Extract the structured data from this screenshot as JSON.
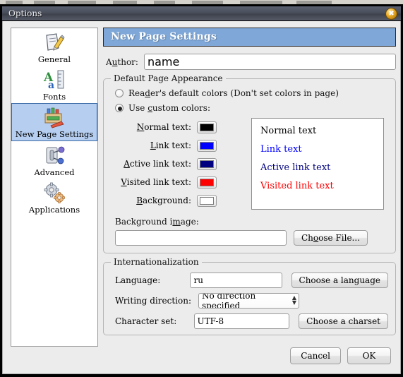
{
  "window": {
    "title": "Options",
    "close_icon": "close-icon"
  },
  "sidebar": {
    "items": [
      {
        "label": "General",
        "icon": "pencil-document-icon",
        "selected": false
      },
      {
        "label": "Fonts",
        "icon": "font-ruler-icon",
        "selected": false
      },
      {
        "label": "New Page Settings",
        "icon": "crayon-box-icon",
        "selected": true
      },
      {
        "label": "Advanced",
        "icon": "toggle-switch-icon",
        "selected": false
      },
      {
        "label": "Applications",
        "icon": "gears-icon",
        "selected": false
      }
    ]
  },
  "page": {
    "header": "New Page Settings",
    "author": {
      "label_pre": "A",
      "label_mnemonic": "u",
      "label_post": "thor:",
      "value": "name",
      "placeholder": ""
    },
    "appearance": {
      "title": "Default Page Appearance",
      "radio_default": {
        "pre": "Rea",
        "mnemonic": "d",
        "post": "er's default colors (Don't set colors in page)",
        "selected": false
      },
      "radio_custom": {
        "pre": "Use ",
        "mnemonic": "c",
        "post": "ustom colors:",
        "selected": true
      },
      "colors": [
        {
          "pre": "",
          "mnemonic": "N",
          "post": "ormal text:",
          "value": "#000000"
        },
        {
          "pre": "",
          "mnemonic": "L",
          "post": "ink text:",
          "value": "#0000ff"
        },
        {
          "pre": "",
          "mnemonic": "A",
          "post": "ctive link text:",
          "value": "#000080"
        },
        {
          "pre": "",
          "mnemonic": "V",
          "post": "isited link text:",
          "value": "#ff0000"
        },
        {
          "pre": "",
          "mnemonic": "B",
          "post": "ackground:",
          "value": "#ffffff"
        }
      ],
      "preview": [
        {
          "text": "Normal text",
          "color": "#000000"
        },
        {
          "text": "Link text",
          "color": "#0000ff"
        },
        {
          "text": "Active link text",
          "color": "#000080"
        },
        {
          "text": "Visited link text",
          "color": "#ff0000"
        }
      ],
      "preview_bg": "#ffffff",
      "bg_image": {
        "pre": "Background i",
        "mnemonic": "m",
        "post": "age:",
        "value": "",
        "placeholder": "",
        "button_pre": "Ch",
        "button_mnemonic": "o",
        "button_post": "ose File..."
      }
    },
    "internationalization": {
      "title": "Internationalization",
      "language": {
        "label": "Language:",
        "value": "ru",
        "button": "Choose a language"
      },
      "writing_direction": {
        "label": "Writing direction:",
        "value": "No direction specified",
        "arrows_icon": "chevron-updown-icon"
      },
      "charset": {
        "label": "Character set:",
        "value": "UTF-8",
        "button": "Choose a charset"
      }
    }
  },
  "footer": {
    "cancel": "Cancel",
    "ok": "OK"
  },
  "colors": {
    "header_blue": "#7fa8d8",
    "selection_blue": "#b6cff0",
    "selection_border": "#3c6ba5",
    "dialog_bg": "#ececec",
    "titlebar": "#4a4f5c"
  }
}
